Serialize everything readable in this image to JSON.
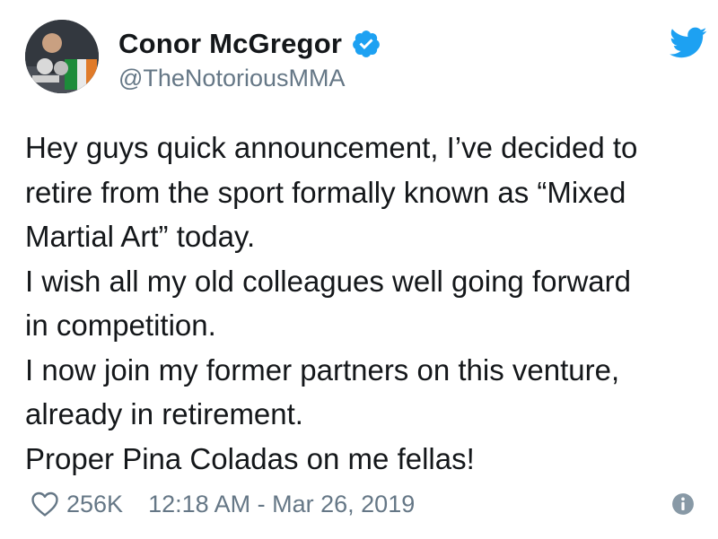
{
  "user": {
    "display_name": "Conor McGregor",
    "handle": "@TheNotoriousMMA",
    "verified": true
  },
  "tweet": {
    "lines": [
      "Hey guys quick announcement, I’ve decided to",
      "retire from the sport formally known as “Mixed",
      "Martial Art” today.",
      "I wish all my old colleagues well going forward",
      "in competition.",
      "I now join my former partners on this venture,",
      "already in retirement.",
      "Proper Pina Coladas on me fellas!"
    ]
  },
  "footer": {
    "likes": "256K",
    "timestamp": "12:18 AM - Mar 26, 2019"
  },
  "colors": {
    "brand_blue": "#1da1f2",
    "text": "#14171a",
    "muted": "#657786"
  },
  "icons": {
    "verified": "verified-badge-icon",
    "brand": "twitter-bird-icon",
    "like": "heart-icon",
    "info": "info-icon"
  }
}
